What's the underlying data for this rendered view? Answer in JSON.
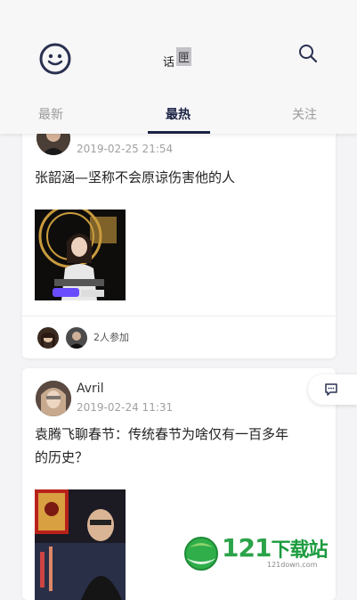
{
  "header": {
    "title_part1": "话",
    "title_part2": "匣",
    "tabs": [
      {
        "label": "最新"
      },
      {
        "label": "最热"
      },
      {
        "label": "关注"
      }
    ]
  },
  "posts": [
    {
      "time": "2019-02-25 21:54",
      "title": "张韶涵—坚称不会原谅伤害他的人",
      "participants_text": "2人参加"
    },
    {
      "username": "Avril",
      "time": "2019-02-24 11:31",
      "title_line1": "袁腾飞聊春节：传统春节为啥仅有一百多年",
      "title_line2": "的历史？"
    }
  ],
  "watermark": {
    "main": "121",
    "cn": "下载站",
    "sub": "121down.com"
  }
}
